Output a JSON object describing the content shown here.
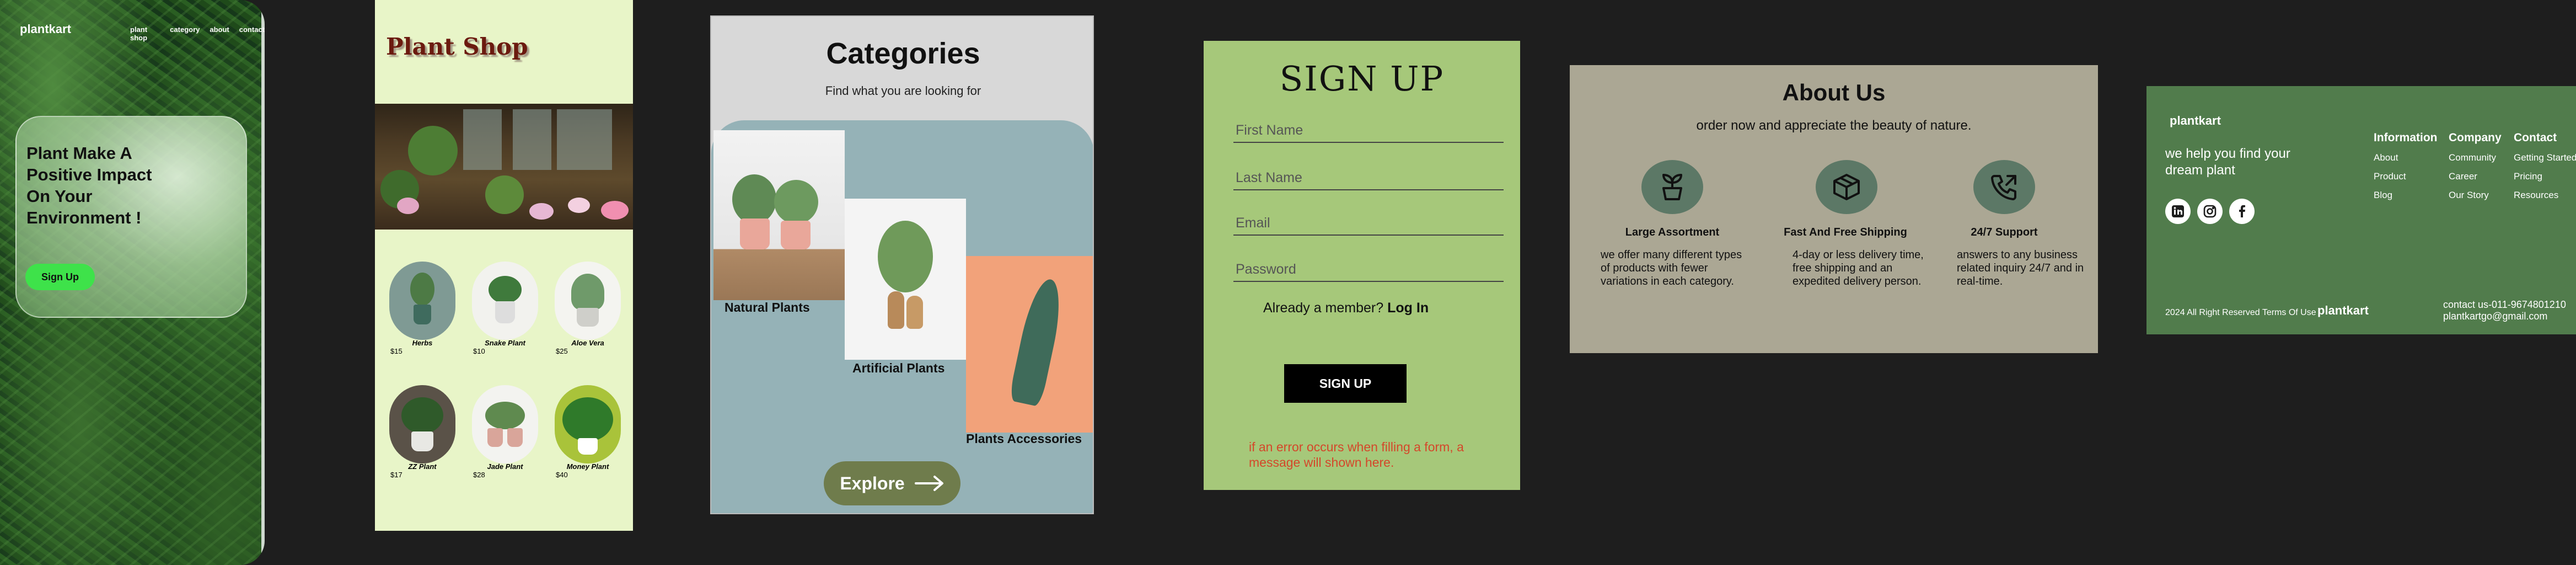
{
  "hero": {
    "brand": "plantkart",
    "nav": [
      "plant shop",
      "category",
      "about",
      "contact"
    ],
    "title_lines": [
      "Plant Make A",
      "Positive Impact",
      "On Your",
      "Environment !"
    ],
    "signup_label": "Sign Up"
  },
  "shop": {
    "title": "Plant Shop",
    "plants": [
      {
        "name": "Herbs",
        "price": "$15"
      },
      {
        "name": "Snake Plant",
        "price": "$10"
      },
      {
        "name": "Aloe Vera",
        "price": "$25"
      },
      {
        "name": "ZZ Plant",
        "price": "$17"
      },
      {
        "name": "Jade Plant",
        "price": "$28"
      },
      {
        "name": "Money Plant",
        "price": "$40"
      }
    ]
  },
  "categories": {
    "title": "Categories",
    "subtitle": "Find what you are looking for",
    "items": [
      "Natural Plants",
      "Artificial Plants",
      "Plants Accessories"
    ],
    "explore_label": "Explore"
  },
  "signup": {
    "title": "SIGN UP",
    "fields": [
      "First Name",
      "Last Name",
      "Email",
      "Password"
    ],
    "member_text": "Already a member?",
    "login_label": "Log In",
    "button_label": "SIGN UP",
    "error_text": "if an error occurs when filling a form, a message will shown here."
  },
  "about": {
    "title": "About Us",
    "subtitle": "order now and appreciate the beauty of nature.",
    "features": [
      {
        "icon": "plant-icon",
        "heading": "Large Assortment",
        "text": "we offer many different types of products with fewer variations in each category."
      },
      {
        "icon": "box-icon",
        "heading": "Fast And Free Shipping",
        "text": "4-day or less delivery time, free shipping and an expedited delivery person."
      },
      {
        "icon": "phone-icon",
        "heading": "24/7 Support",
        "text": "answers to any business related inquiry 24/7 and in real-time."
      }
    ]
  },
  "footer": {
    "brand": "plantkart",
    "tagline": "we help you  find your dream plant",
    "columns": [
      {
        "heading": "Information",
        "links": [
          "About",
          "Product",
          "Blog"
        ]
      },
      {
        "heading": "Company",
        "links": [
          "Community",
          "Career",
          "Our Story"
        ]
      },
      {
        "heading": "Contact",
        "links": [
          "Getting Started",
          "Pricing",
          "Resources"
        ]
      }
    ],
    "copyright": "2024 All Right Reserved Terms Of Use",
    "copyright_brand": "plantkart",
    "contact_phone": "contact us-011-9674801210",
    "contact_email": "plantkartgo@gmail.com"
  },
  "colors": {
    "hero_button": "#3ee24a",
    "shop_bg": "#e8f5c8",
    "signup_bg": "#a6c87a",
    "about_bg": "#aba794",
    "footer_bg": "#517c4c",
    "error_text": "#d4472a"
  }
}
